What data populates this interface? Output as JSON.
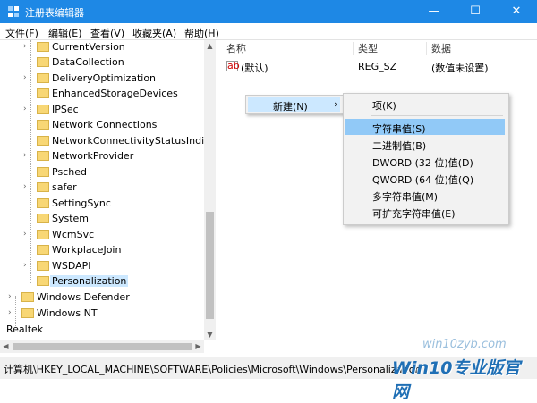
{
  "window": {
    "title": "注册表编辑器",
    "controls": {
      "minimize": "—",
      "maximize": "☐",
      "close": "✕"
    }
  },
  "menu": [
    "文件(F)",
    "编辑(E)",
    "查看(V)",
    "收藏夹(A)",
    "帮助(H)"
  ],
  "tree": {
    "items": [
      {
        "label": "CurrentVersion",
        "expandable": true
      },
      {
        "label": "DataCollection",
        "expandable": false
      },
      {
        "label": "DeliveryOptimization",
        "expandable": true
      },
      {
        "label": "EnhancedStorageDevices",
        "expandable": false
      },
      {
        "label": "IPSec",
        "expandable": true
      },
      {
        "label": "Network Connections",
        "expandable": false
      },
      {
        "label": "NetworkConnectivityStatusIndicat",
        "expandable": false
      },
      {
        "label": "NetworkProvider",
        "expandable": true
      },
      {
        "label": "Psched",
        "expandable": false
      },
      {
        "label": "safer",
        "expandable": true
      },
      {
        "label": "SettingSync",
        "expandable": false
      },
      {
        "label": "System",
        "expandable": false
      },
      {
        "label": "WcmSvc",
        "expandable": true
      },
      {
        "label": "WorkplaceJoin",
        "expandable": false
      },
      {
        "label": "WSDAPI",
        "expandable": true
      },
      {
        "label": "Personalization",
        "expandable": false,
        "selected": true
      }
    ],
    "parent_items": [
      {
        "label": "Windows Defender",
        "expandable": true
      },
      {
        "label": "Windows NT",
        "expandable": true
      }
    ],
    "root_item": {
      "label": "Realtek"
    }
  },
  "values_pane": {
    "columns": {
      "name": "名称",
      "type": "类型",
      "data": "数据"
    },
    "rows": [
      {
        "icon": "ab",
        "name": "(默认)",
        "type": "REG_SZ",
        "data": "(数值未设置)"
      }
    ]
  },
  "context_menu": {
    "new_label": "新建(N)",
    "new_arrow": "›",
    "submenu": {
      "key": "项(K)",
      "items": [
        {
          "label": "字符串值(S)",
          "active": true
        },
        {
          "label": "二进制值(B)"
        },
        {
          "label": "DWORD (32 位)值(D)"
        },
        {
          "label": "QWORD (64 位)值(Q)"
        },
        {
          "label": "多字符串值(M)"
        },
        {
          "label": "可扩充字符串值(E)"
        }
      ]
    }
  },
  "statusbar": {
    "path": "计算机\\HKEY_LOCAL_MACHINE\\SOFTWARE\\Policies\\Microsoft\\Windows\\Personalization"
  },
  "watermark": {
    "site": "win10zyb.com",
    "brand": "Win10专业版官网"
  },
  "colors": {
    "titlebar": "#1e88e5",
    "selection": "#cce8ff",
    "menu_active": "#91c9f7"
  }
}
